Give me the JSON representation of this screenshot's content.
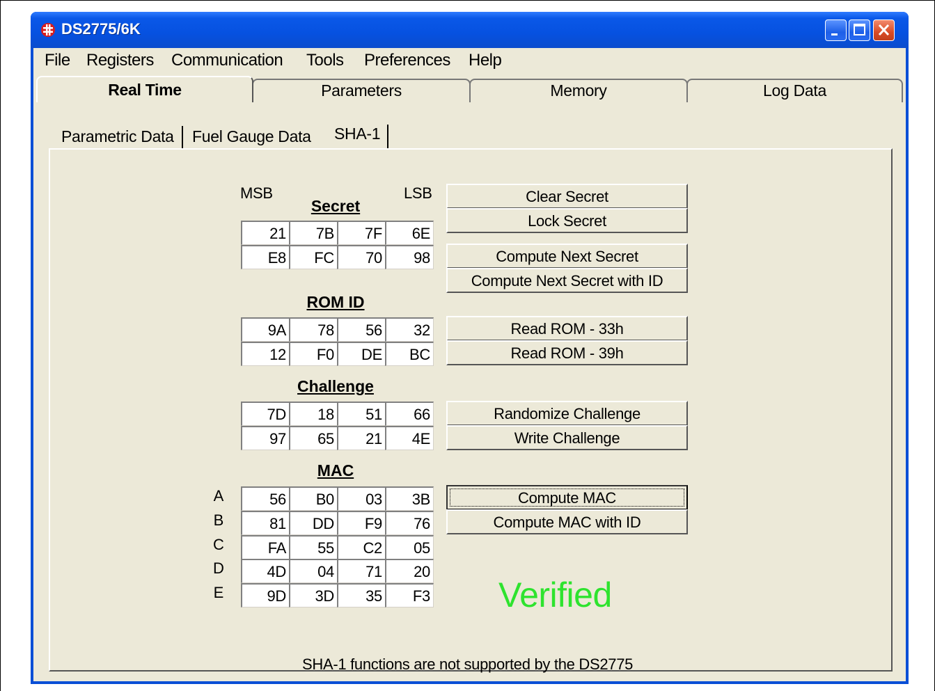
{
  "window": {
    "title": "DS2775/6K"
  },
  "menu": [
    "File",
    "Registers",
    "Communication",
    "Tools",
    "Preferences",
    "Help"
  ],
  "main_tabs": [
    "Real Time",
    "Parameters",
    "Memory",
    "Log Data"
  ],
  "sub_tabs": [
    "Parametric Data",
    "Fuel Gauge Data",
    "SHA-1"
  ],
  "labels": {
    "msb": "MSB",
    "lsb": "LSB"
  },
  "secret": {
    "title": "Secret",
    "rows": [
      [
        "21",
        "7B",
        "7F",
        "6E"
      ],
      [
        "E8",
        "FC",
        "70",
        "98"
      ]
    ],
    "buttons": [
      "Clear Secret",
      "Lock Secret",
      "Compute Next Secret",
      "Compute Next Secret with ID"
    ]
  },
  "rom_id": {
    "title": "ROM ID",
    "rows": [
      [
        "9A",
        "78",
        "56",
        "32"
      ],
      [
        "12",
        "F0",
        "DE",
        "BC"
      ]
    ],
    "buttons": [
      "Read ROM - 33h",
      "Read ROM - 39h"
    ]
  },
  "challenge": {
    "title": "Challenge",
    "rows": [
      [
        "7D",
        "18",
        "51",
        "66"
      ],
      [
        "97",
        "65",
        "21",
        "4E"
      ]
    ],
    "buttons": [
      "Randomize Challenge",
      "Write Challenge"
    ]
  },
  "mac": {
    "title": "MAC",
    "row_labels": [
      "A",
      "B",
      "C",
      "D",
      "E"
    ],
    "rows": [
      [
        "56",
        "B0",
        "03",
        "3B"
      ],
      [
        "81",
        "DD",
        "F9",
        "76"
      ],
      [
        "FA",
        "55",
        "C2",
        "05"
      ],
      [
        "4D",
        "04",
        "71",
        "20"
      ],
      [
        "9D",
        "3D",
        "35",
        "F3"
      ]
    ],
    "buttons": [
      "Compute MAC",
      "Compute MAC with ID"
    ]
  },
  "status_text": "Verified",
  "status_color": "#2ee32e",
  "note": "SHA-1 functions are not supported by the DS2775"
}
